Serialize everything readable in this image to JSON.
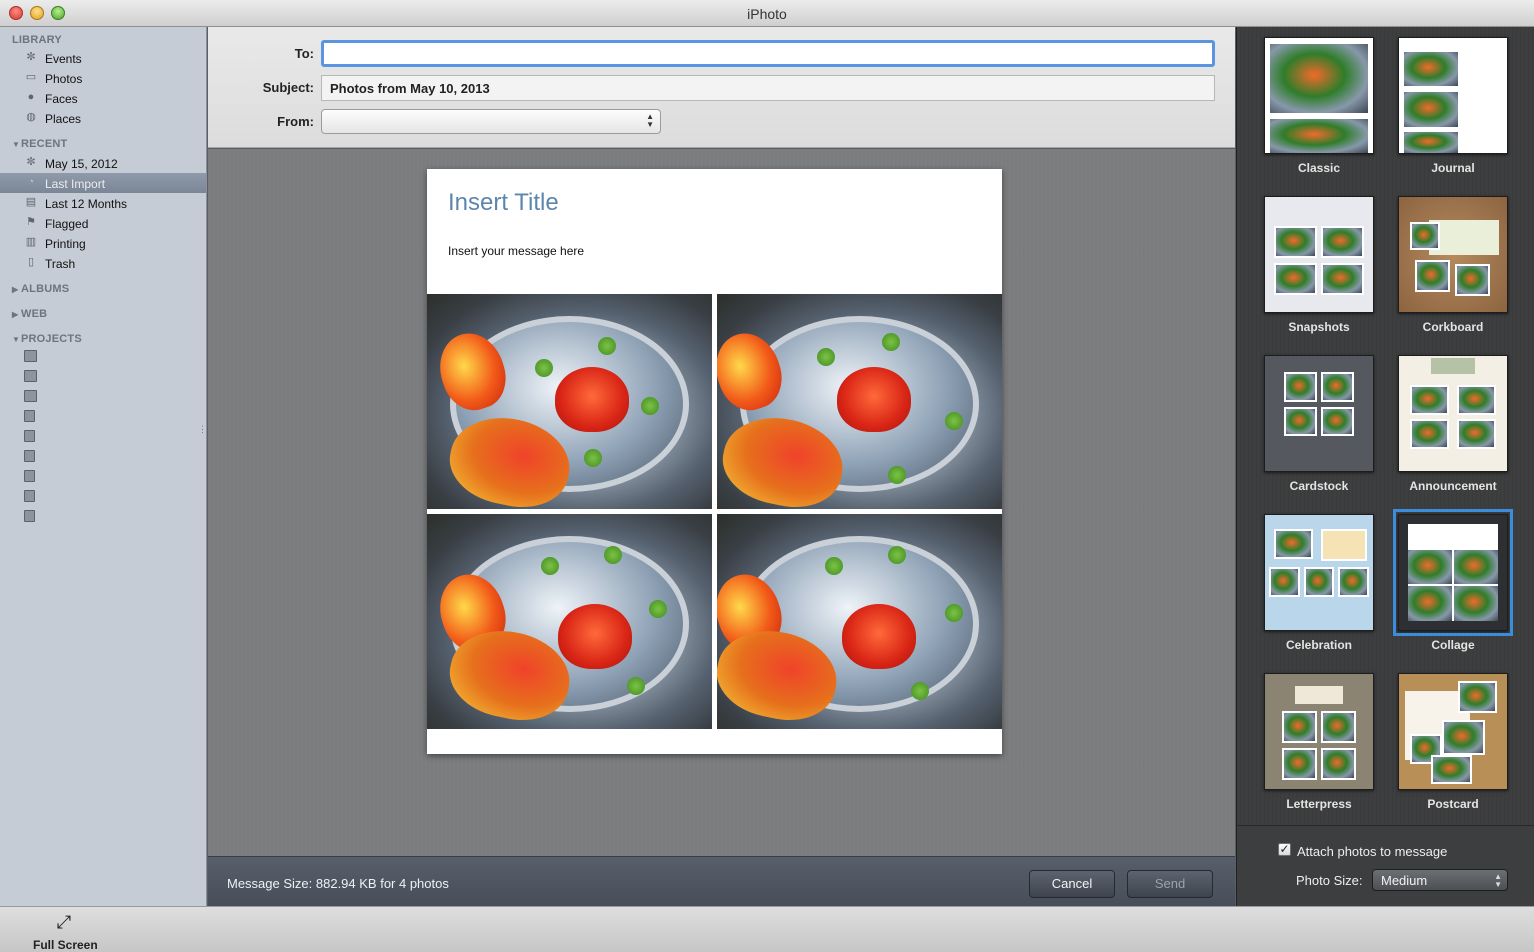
{
  "window": {
    "title": "iPhoto"
  },
  "sidebar": {
    "library": {
      "heading": "LIBRARY",
      "items": [
        {
          "label": "Events",
          "icon": "events-icon"
        },
        {
          "label": "Photos",
          "icon": "photos-icon"
        },
        {
          "label": "Faces",
          "icon": "faces-icon"
        },
        {
          "label": "Places",
          "icon": "places-icon"
        }
      ]
    },
    "recent": {
      "heading": "RECENT",
      "items": [
        {
          "label": "May 15, 2012",
          "icon": "event-icon"
        },
        {
          "label": "Last Import",
          "icon": "last-import-icon",
          "selected": true
        },
        {
          "label": "Last 12 Months",
          "icon": "calendar-icon"
        },
        {
          "label": "Flagged",
          "icon": "flag-icon"
        },
        {
          "label": "Printing",
          "icon": "printer-icon"
        },
        {
          "label": "Trash",
          "icon": "trash-icon"
        }
      ]
    },
    "albums": {
      "heading": "ALBUMS"
    },
    "web": {
      "heading": "WEB"
    },
    "projects": {
      "heading": "PROJECTS"
    }
  },
  "compose": {
    "to_label": "To:",
    "to_value": "",
    "subject_label": "Subject:",
    "subject_value": "Photos from May 10, 2013",
    "from_label": "From:",
    "from_value": ""
  },
  "preview": {
    "title": "Insert Title",
    "message": "Insert your message here"
  },
  "footer": {
    "message_size": "Message Size: 882.94 KB for 4 photos",
    "cancel_label": "Cancel",
    "send_label": "Send"
  },
  "themes": [
    {
      "name": "Classic"
    },
    {
      "name": "Journal"
    },
    {
      "name": "Snapshots"
    },
    {
      "name": "Corkboard"
    },
    {
      "name": "Cardstock"
    },
    {
      "name": "Announcement"
    },
    {
      "name": "Celebration"
    },
    {
      "name": "Collage",
      "selected": true
    },
    {
      "name": "Letterpress"
    },
    {
      "name": "Postcard"
    }
  ],
  "attach": {
    "checkbox_label": "Attach photos to message",
    "checked": true,
    "photo_size_label": "Photo Size:",
    "photo_size_value": "Medium"
  },
  "bottombar": {
    "full_screen_label": "Full Screen"
  },
  "colors": {
    "focus_ring": "#5b95e2",
    "selection": "#3b8ddc",
    "title_text": "#5e86ad"
  }
}
